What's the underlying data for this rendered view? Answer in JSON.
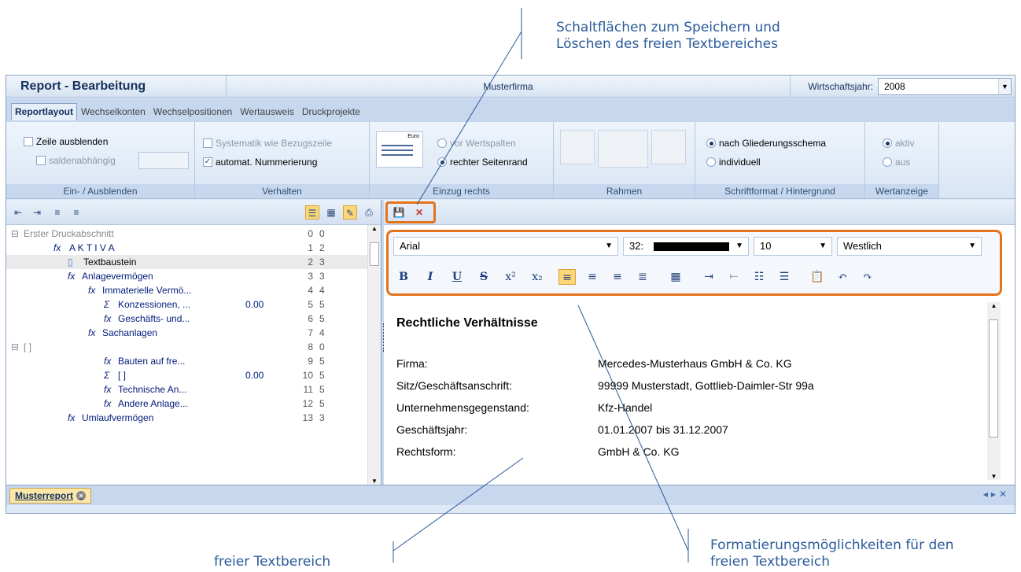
{
  "callouts": {
    "top": "Schaltflächen zum Speichern und Löschen des freien Textbereiches",
    "bottom_left": "freier Textbereich",
    "bottom_right": "Formatierungsmöglichkeiten für den freien Textbereich"
  },
  "header": {
    "title": "Report - Bearbeitung",
    "company": "Musterfirma",
    "year_label": "Wirtschaftsjahr:",
    "year_value": "2008"
  },
  "tabs": [
    "Reportlayout",
    "Wechselkonten",
    "Wechselpositionen",
    "Wertausweis",
    "Druckprojekte"
  ],
  "ribbon": {
    "g1": {
      "zeile": "Zeile ausblenden",
      "saldo": "saldenabhängig",
      "label": "Ein- / Ausblenden"
    },
    "g2": {
      "syst": "Systematik wie Bezugszeile",
      "auto": "automat. Nummerierung",
      "label": "Verhalten"
    },
    "g3": {
      "pic": "Euro",
      "vor": "vor Wertspalten",
      "rechter": "rechter Seitenrand",
      "label": "Einzug rechts"
    },
    "g4": {
      "label": "Rahmen"
    },
    "g5": {
      "nach": "nach Gliederungsschema",
      "indiv": "individuell",
      "label": "Schriftformat / Hintergrund"
    },
    "g6": {
      "aktiv": "aktiv",
      "aus": "aus",
      "label": "Wertanzeige"
    }
  },
  "tree": [
    {
      "label": "Erster Druckabschnitt",
      "v": "",
      "n1": "0",
      "n2": "0"
    },
    {
      "label": "A K T I V A",
      "v": "",
      "n1": "1",
      "n2": "2"
    },
    {
      "label": "Textbaustein",
      "v": "",
      "n1": "2",
      "n2": "3"
    },
    {
      "label": "Anlagevermögen",
      "v": "",
      "n1": "3",
      "n2": "3"
    },
    {
      "label": "Immaterielle Vermö...",
      "v": "",
      "n1": "4",
      "n2": "4"
    },
    {
      "label": "Konzessionen, ...",
      "v": "0.00",
      "n1": "5",
      "n2": "5"
    },
    {
      "label": "Geschäfts- und...",
      "v": "",
      "n1": "6",
      "n2": "5"
    },
    {
      "label": "Sachanlagen",
      "v": "",
      "n1": "7",
      "n2": "4"
    },
    {
      "label": "[ ]",
      "v": "",
      "n1": "8",
      "n2": "0"
    },
    {
      "label": "Bauten auf fre...",
      "v": "",
      "n1": "9",
      "n2": "5"
    },
    {
      "label": "[ ]",
      "v": "0.00",
      "n1": "10",
      "n2": "5"
    },
    {
      "label": "Technische An...",
      "v": "",
      "n1": "11",
      "n2": "5"
    },
    {
      "label": "Andere Anlage...",
      "v": "",
      "n1": "12",
      "n2": "5"
    },
    {
      "label": "Umlaufvermögen",
      "v": "",
      "n1": "13",
      "n2": "3"
    }
  ],
  "format": {
    "font": "Arial",
    "color": "32:",
    "size": "10",
    "script": "Westlich"
  },
  "editor": {
    "heading": "Rechtliche Verhältnisse",
    "rows": [
      {
        "k": "Firma:",
        "v": "Mercedes-Musterhaus GmbH & Co. KG"
      },
      {
        "k": "Sitz/Geschäftsanschrift:",
        "v": "99999 Musterstadt, Gottlieb-Daimler-Str 99a"
      },
      {
        "k": "Unternehmensgegenstand:",
        "v": "Kfz-Handel"
      },
      {
        "k": "Geschäftsjahr:",
        "v": "01.01.2007 bis 31.12.2007"
      },
      {
        "k": "Rechtsform:",
        "v": "GmbH & Co. KG"
      }
    ]
  },
  "bottom": {
    "doctab": "Musterreport"
  }
}
